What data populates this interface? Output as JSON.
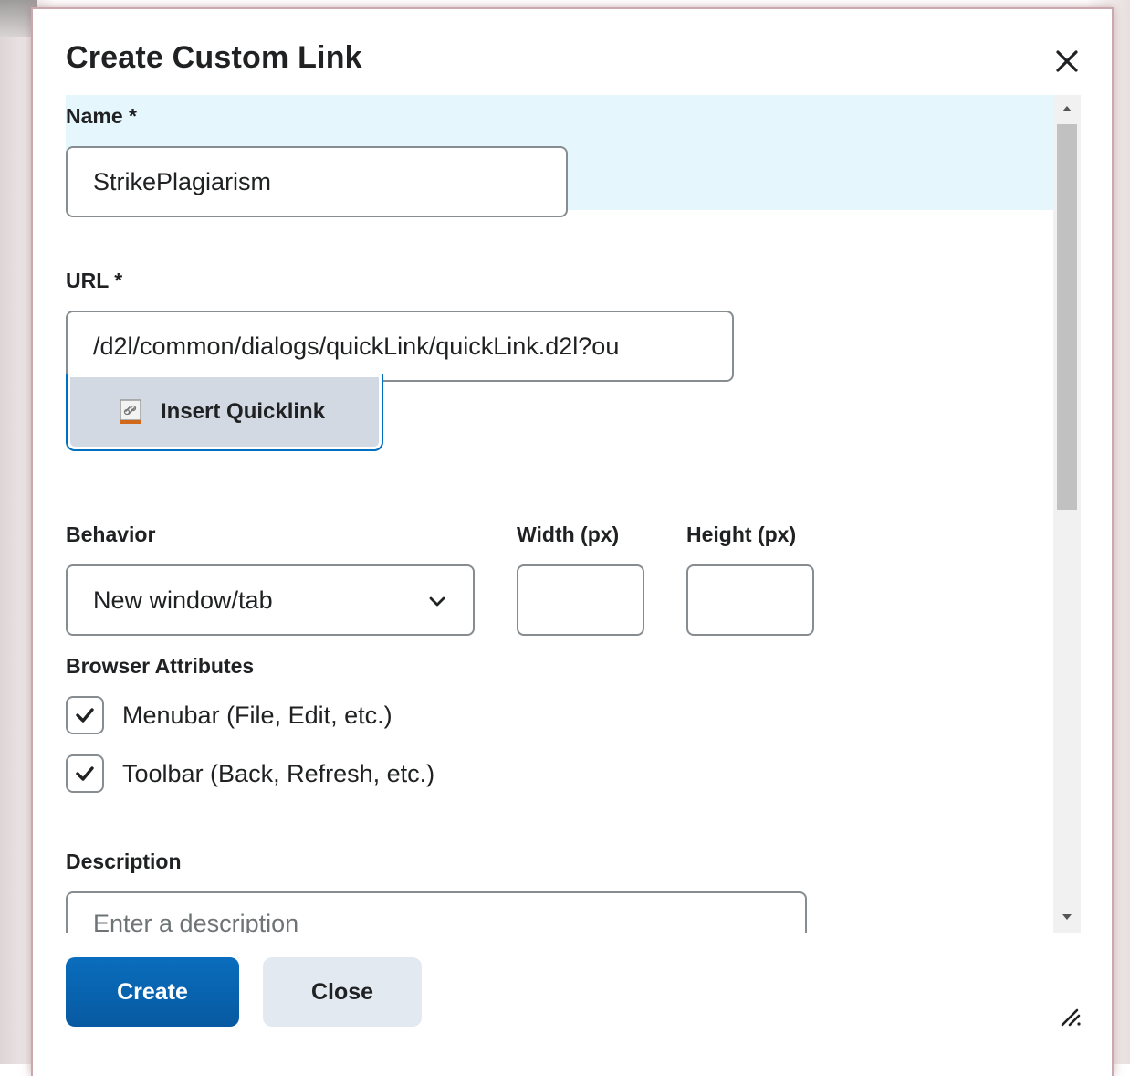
{
  "dialog": {
    "title": "Create Custom Link",
    "close_icon": "close-icon"
  },
  "form": {
    "name_label": "Name *",
    "name_value": "StrikePlagiarism",
    "url_label": "URL *",
    "url_value": "/d2l/common/dialogs/quickLink/quickLink.d2l?ou",
    "insert_quicklink_label": "Insert Quicklink",
    "insert_quicklink_icon": "quicklink-icon",
    "behavior_label": "Behavior",
    "behavior_value": "New window/tab",
    "width_label": "Width (px)",
    "width_value": "",
    "height_label": "Height (px)",
    "height_value": "",
    "browser_attributes_label": "Browser Attributes",
    "checkboxes": [
      {
        "label": "Menubar (File, Edit, etc.)",
        "checked": true
      },
      {
        "label": "Toolbar (Back, Refresh, etc.)",
        "checked": true
      }
    ],
    "description_label": "Description",
    "description_placeholder": "Enter a description"
  },
  "footer": {
    "create_label": "Create",
    "close_label": "Close"
  },
  "colors": {
    "primary": "#075aa1",
    "focus": "#006fbf",
    "highlight": "#e6f6fd",
    "secondary_button": "#e3e9f1"
  }
}
